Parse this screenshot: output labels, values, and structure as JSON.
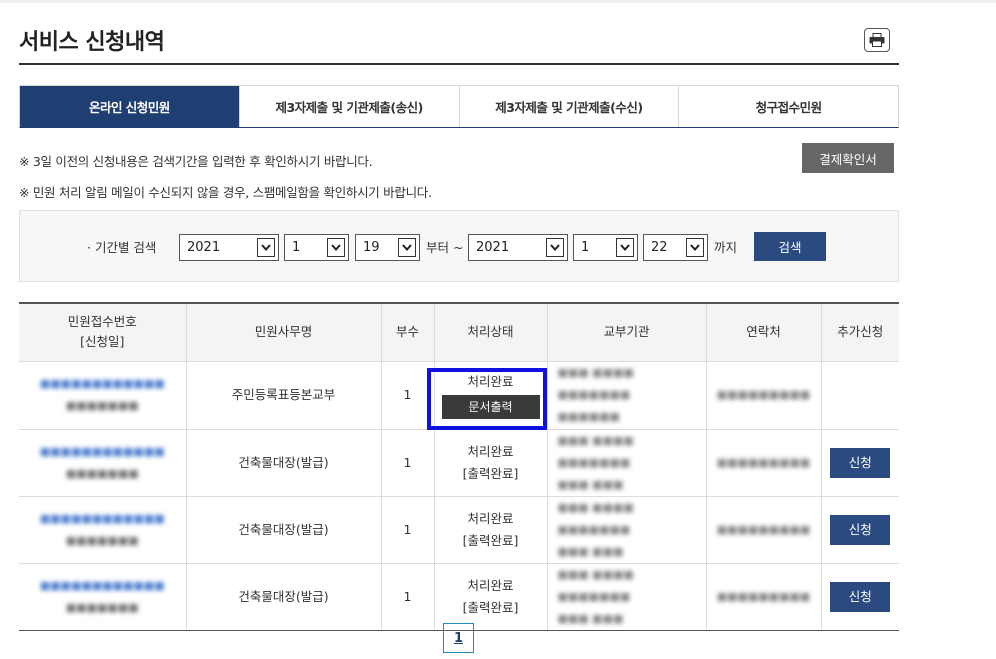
{
  "page": {
    "title": "서비스 신청내역"
  },
  "icons": {
    "print": "print-icon",
    "dropdown": "chevron-down-icon"
  },
  "colors": {
    "accent": "#1f3f73",
    "button_dark": "#666666",
    "highlight": "#1010e0"
  },
  "tabs": [
    {
      "label": "온라인 신청민원",
      "active": true
    },
    {
      "label": "제3자제출 및 기관제출(송신)",
      "active": false
    },
    {
      "label": "제3자제출 및 기관제출(수신)",
      "active": false
    },
    {
      "label": "청구접수민원",
      "active": false
    }
  ],
  "notices": [
    "※ 3일 이전의 신청내용은 검색기간을 입력한 후 확인하시기 바랍니다.",
    "※ 민원 처리 알림 메일이 수신되지 않을 경우, 스팸메일함을 확인하시기 바랍니다."
  ],
  "payment_button": "결제확인서",
  "search": {
    "label": "· 기간별 검색",
    "from_year": "2021",
    "from_month": "1",
    "from_day": "19",
    "from_suffix": "부터 ~",
    "to_year": "2021",
    "to_month": "1",
    "to_day": "22",
    "to_suffix": "까지",
    "button": "검색"
  },
  "table": {
    "headers": [
      "민원접수번호",
      "[신청일]",
      "민원사무명",
      "부수",
      "처리상태",
      "교부기관",
      "연락처",
      "추가신청"
    ],
    "rows": [
      {
        "name": "주민등록표등본교부",
        "copies": "1",
        "status": "처리완료",
        "action": "문서출력",
        "extra": ""
      },
      {
        "name": "건축물대장(발급)",
        "copies": "1",
        "status": "처리완료",
        "status2": "[출력완료]",
        "extra": "신청"
      },
      {
        "name": "건축물대장(발급)",
        "copies": "1",
        "status": "처리완료",
        "status2": "[출력완료]",
        "extra": "신청"
      },
      {
        "name": "건축물대장(발급)",
        "copies": "1",
        "status": "처리완료",
        "status2": "[출력완료]",
        "extra": "신청"
      }
    ]
  },
  "pagination": {
    "current": "1"
  }
}
